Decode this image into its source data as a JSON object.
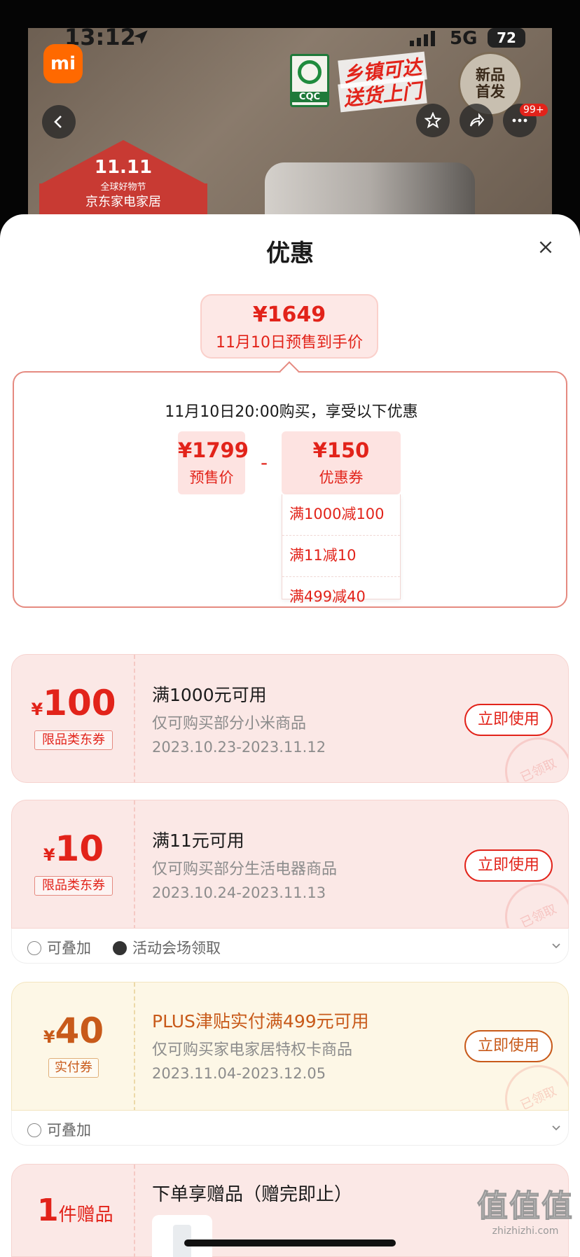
{
  "status_bar": {
    "time": "13:12",
    "network": "5G",
    "battery": "72"
  },
  "product_header": {
    "brand_logo": "mi",
    "cert_label": "CQC",
    "promo_line1": "乡镇可达",
    "promo_line2": "送货上门",
    "new_badge_line1": "新品",
    "new_badge_line2": "首发",
    "cart_badge": "99+",
    "event_title": "11.11",
    "event_sub1": "全球好物节",
    "event_sub2": "京东家电家居"
  },
  "sheet": {
    "title": "优惠",
    "final_price": {
      "value": "¥1649",
      "label": "11月10日预售到手价"
    },
    "calc": {
      "note": "11月10日20:00购买，享受以下优惠",
      "presale": {
        "value": "¥1799",
        "label": "预售价"
      },
      "minus": "-",
      "coupon": {
        "value": "¥150",
        "label": "优惠券"
      },
      "coupon_breakdown": [
        "满1000减100",
        "满11减10",
        "满499减40"
      ]
    }
  },
  "coupons": [
    {
      "currency": "¥",
      "amount": "100",
      "tag": "限品类东券",
      "condition": "满1000元可用",
      "desc": "仅可购买部分小米商品",
      "date": "2023.10.23-2023.11.12",
      "button": "立即使用",
      "stamp": "已领取"
    },
    {
      "currency": "¥",
      "amount": "10",
      "tag": "限品类东券",
      "condition": "满11元可用",
      "desc": "仅可购买部分生活电器商品",
      "date": "2023.10.24-2023.11.13",
      "button": "立即使用",
      "stamp": "已领取",
      "footer": [
        "可叠加",
        "活动会场领取"
      ]
    },
    {
      "currency": "¥",
      "amount": "40",
      "tag": "实付券",
      "condition": "PLUS津贴实付满499元可用",
      "desc": "仅可购买家电家居特权卡商品",
      "date": "2023.11.04-2023.12.05",
      "button": "立即使用",
      "stamp": "已领取",
      "footer": [
        "可叠加"
      ]
    }
  ],
  "gift": {
    "count": "1",
    "count_label": "件赠品",
    "title": "下单享赠品（赠完即止）"
  },
  "watermark": {
    "big": "值值值",
    "small": "zhizhizhi.com"
  },
  "colors": {
    "accent": "#e2231a",
    "gold": "#c85a1a",
    "card_red_bg": "#fbe8e6",
    "card_gold_bg": "#fdf7e6"
  }
}
